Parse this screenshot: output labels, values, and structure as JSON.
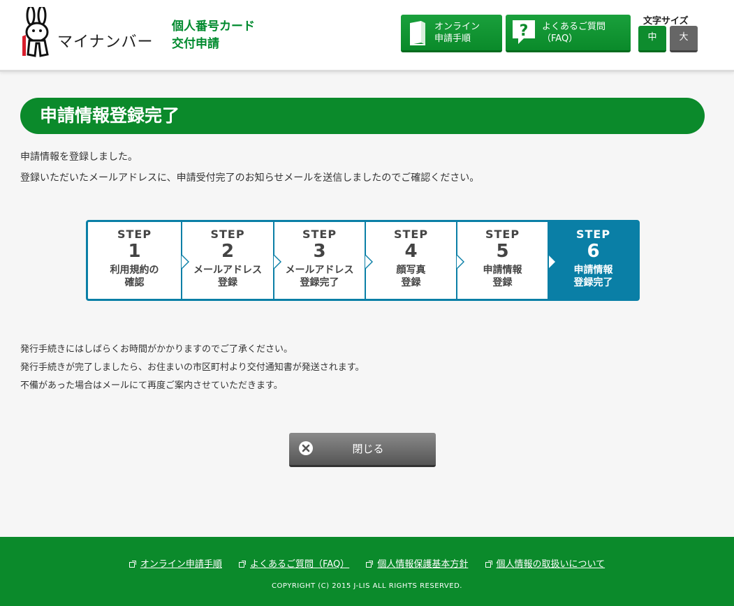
{
  "header": {
    "logo_text": "マイナンバー",
    "service_title_line1": "個人番号カード",
    "service_title_line2": "交付申請",
    "online_button": "オンライン\n申請手順",
    "faq_button": "よくあるご質問\n（FAQ）",
    "font_size_label": "文字サイズ",
    "font_size_medium": "中",
    "font_size_large": "大"
  },
  "page": {
    "title": "申請情報登録完了",
    "intro_line1": "申請情報を登録しました。",
    "intro_line2": "登録いただいたメールアドレスに、申請受付完了のお知らせメールを送信しましたのでご確認ください。"
  },
  "steps": [
    {
      "label": "STEP",
      "num": "1",
      "line1": "利用規約の",
      "line2": "確認"
    },
    {
      "label": "STEP",
      "num": "2",
      "line1": "メールアドレス",
      "line2": "登録"
    },
    {
      "label": "STEP",
      "num": "3",
      "line1": "メールアドレス",
      "line2": "登録完了"
    },
    {
      "label": "STEP",
      "num": "4",
      "line1": "顔写真",
      "line2": "登録"
    },
    {
      "label": "STEP",
      "num": "5",
      "line1": "申請情報",
      "line2": "登録"
    },
    {
      "label": "STEP",
      "num": "6",
      "line1": "申請情報",
      "line2": "登録完了"
    }
  ],
  "notes": {
    "line1": "発行手続きにはしばらくお時間がかかりますのでご了承ください。",
    "line2": "発行手続きが完了しましたら、お住まいの市区町村より交付通知書が発送されます。",
    "line3": "不備があった場合はメールにて再度ご案内させていただきます。"
  },
  "close_button": "閉じる",
  "footer": {
    "links": [
      "オンライン申請手順",
      "よくあるご質問（FAQ）",
      "個人情報保護基本方針",
      "個人情報の取扱いについて"
    ],
    "copyright": "COPYRIGHT (C) 2015 J-LIS ALL RIGHTS RESERVED."
  },
  "colors": {
    "brand_green": "#0b8a2b",
    "step_blue": "#0a7fa6",
    "close_gray": "#666666"
  },
  "icons": {
    "online_button": "book-icon",
    "faq_button": "question-icon",
    "close_button": "close-circle-icon",
    "footer_link": "external-link-icon"
  }
}
